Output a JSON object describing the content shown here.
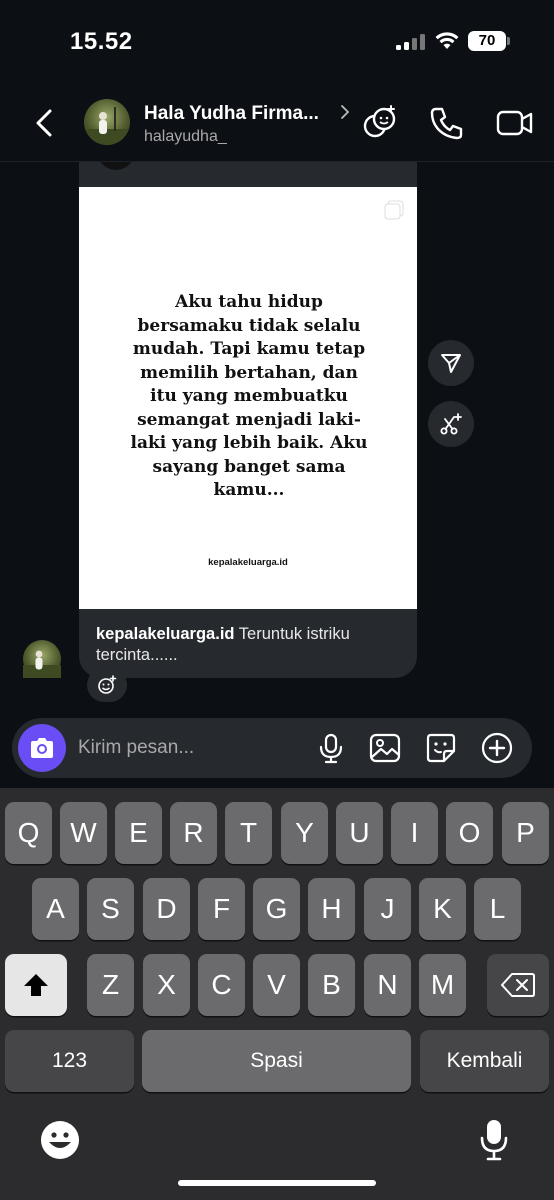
{
  "status": {
    "time": "15.52",
    "battery": "70"
  },
  "header": {
    "name": "Hala Yudha Firma...",
    "username": "halayudha_"
  },
  "post": {
    "quote": "Aku tahu hidup bersamaku tidak selalu mudah. Tapi kamu tetap memilih bertahan, dan itu yang membuatku semangat menjadi laki-laki yang lebih baik. Aku sayang banget sama kamu...",
    "watermark": "kepalakeluarga.id",
    "caption_account": "kepalakeluarga.id",
    "caption_text": "Teruntuk istriku tercinta......"
  },
  "composer": {
    "placeholder": "Kirim pesan..."
  },
  "keyboard": {
    "row1": [
      "Q",
      "W",
      "E",
      "R",
      "T",
      "Y",
      "U",
      "I",
      "O",
      "P"
    ],
    "row2": [
      "A",
      "S",
      "D",
      "F",
      "G",
      "H",
      "J",
      "K",
      "L"
    ],
    "row3": [
      "Z",
      "X",
      "C",
      "V",
      "B",
      "N",
      "M"
    ],
    "numbers": "123",
    "space": "Spasi",
    "return": "Kembali"
  },
  "icons": {
    "back": "chevron-left-icon",
    "effects": "sparkle-faces-icon",
    "call": "phone-icon",
    "video": "video-camera-icon",
    "share": "send-icon",
    "remix": "remix-icon",
    "react": "add-reaction-icon",
    "camera": "camera-icon",
    "mic": "microphone-icon",
    "gallery": "image-icon",
    "sticker": "sticker-icon",
    "more": "plus-circle-icon"
  },
  "colors": {
    "background": "#0c1014",
    "bubble": "#262a2f",
    "camera_button": "#6a4df5",
    "keyboard": "#2c2c2e",
    "key": "#6b6b6d"
  }
}
